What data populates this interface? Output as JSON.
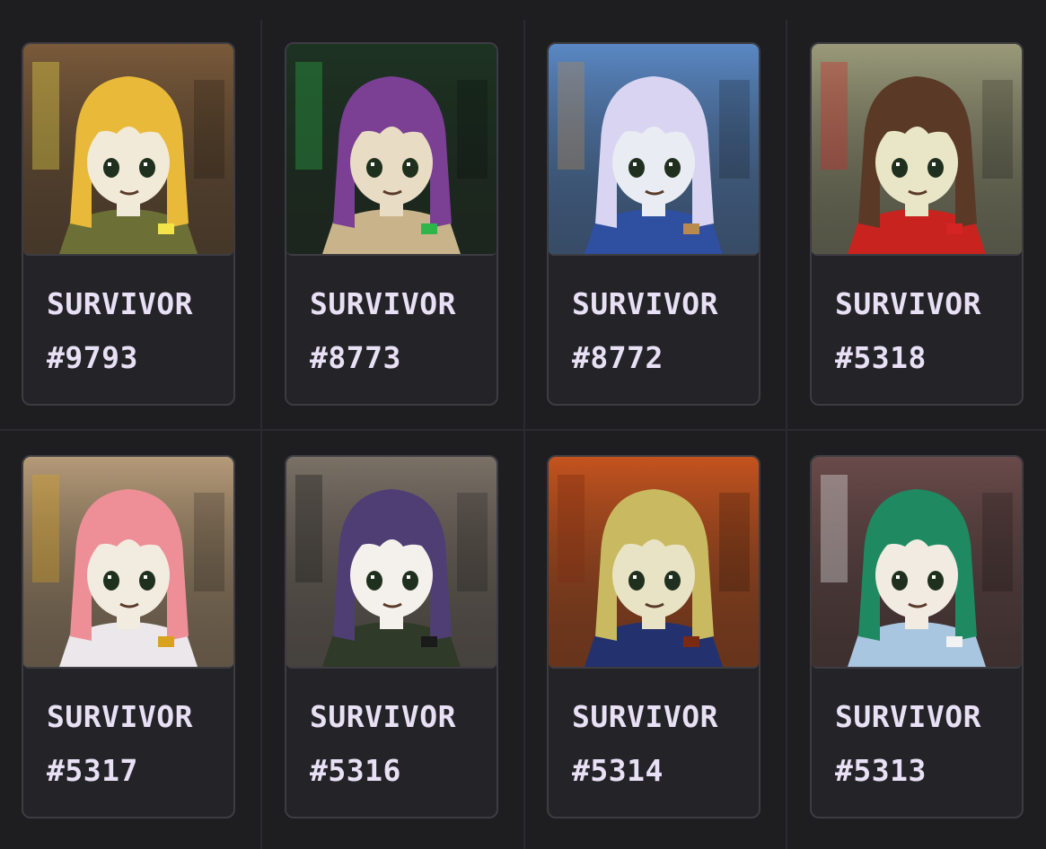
{
  "cards": [
    {
      "title": "SURVIVOR",
      "number": "#9793",
      "bg": "#7a5a3a",
      "hair": "#e9b93a",
      "face": "#f1ead8",
      "outfit": "#6c7036",
      "accent": "#f3e34b",
      "avatar_icon": "sleep-mask-avatar-icon"
    },
    {
      "title": "SURVIVOR",
      "number": "#8773",
      "bg": "#1d3322",
      "hair": "#7b3f94",
      "face": "#e8dcc4",
      "outfit": "#c9b38a",
      "accent": "#2fb54a",
      "avatar_icon": "purple-hair-avatar-icon"
    },
    {
      "title": "SURVIVOR",
      "number": "#8772",
      "bg": "#5a88c4",
      "hair": "#d8d4f2",
      "face": "#e9ecf2",
      "outfit": "#2f4fa0",
      "accent": "#b98a4e",
      "avatar_icon": "goggles-hat-avatar-icon"
    },
    {
      "title": "SURVIVOR",
      "number": "#5318",
      "bg": "#9a9a7a",
      "hair": "#5a3a26",
      "face": "#e9e6c8",
      "outfit": "#c8231f",
      "accent": "#d42424",
      "avatar_icon": "santa-hat-avatar-icon"
    },
    {
      "title": "SURVIVOR",
      "number": "#5317",
      "bg": "#b59a78",
      "hair": "#ee8f98",
      "face": "#f2ece0",
      "outfit": "#ece7ea",
      "accent": "#d9a21e",
      "avatar_icon": "pink-hair-avatar-icon"
    },
    {
      "title": "SURVIVOR",
      "number": "#5316",
      "bg": "#7a7066",
      "hair": "#4f3e74",
      "face": "#f4f1ec",
      "outfit": "#2f3a28",
      "accent": "#1a1a1a",
      "avatar_icon": "skull-mask-avatar-icon"
    },
    {
      "title": "SURVIVOR",
      "number": "#5314",
      "bg": "#c4531e",
      "hair": "#c9ba62",
      "face": "#e9e3c6",
      "outfit": "#23316e",
      "accent": "#7a2a10",
      "avatar_icon": "braids-headset-avatar-icon"
    },
    {
      "title": "SURVIVOR",
      "number": "#5313",
      "bg": "#6a4a4a",
      "hair": "#1f8a62",
      "face": "#f1ebe2",
      "outfit": "#a9c6e0",
      "accent": "#f2f2f2",
      "avatar_icon": "green-hair-avatar-icon"
    }
  ]
}
